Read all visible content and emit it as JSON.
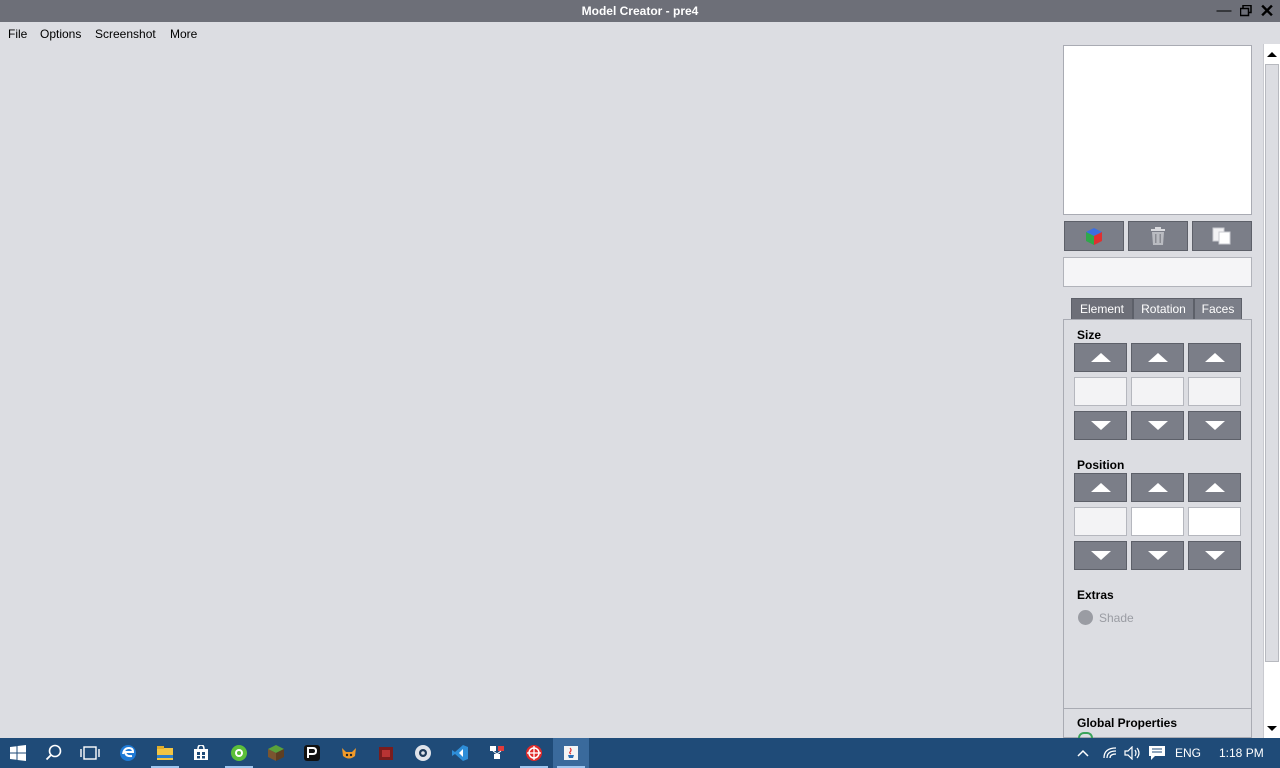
{
  "window": {
    "title": "Model Creator - pre4"
  },
  "menu": {
    "file": "File",
    "options": "Options",
    "screenshot": "Screenshot",
    "more": "More"
  },
  "tabs": {
    "element": "Element",
    "rotation": "Rotation",
    "faces": "Faces",
    "active": "Element"
  },
  "panel": {
    "size_title": "Size",
    "position_title": "Position",
    "extras_title": "Extras",
    "shade_label": "Shade",
    "global_title": "Global Properties",
    "size_values": [
      "",
      "",
      ""
    ],
    "position_values": [
      "",
      "",
      ""
    ]
  },
  "tools": {
    "add_icon": "cube-icon",
    "delete_icon": "trash-icon",
    "duplicate_icon": "copy-icon"
  },
  "taskbar": {
    "language": "ENG",
    "time": "1:18 PM"
  },
  "colors": {
    "titlebar": "#6d6f78",
    "background": "#dcdde2",
    "button": "#7b7e88",
    "taskbar": "#1f4b78"
  }
}
